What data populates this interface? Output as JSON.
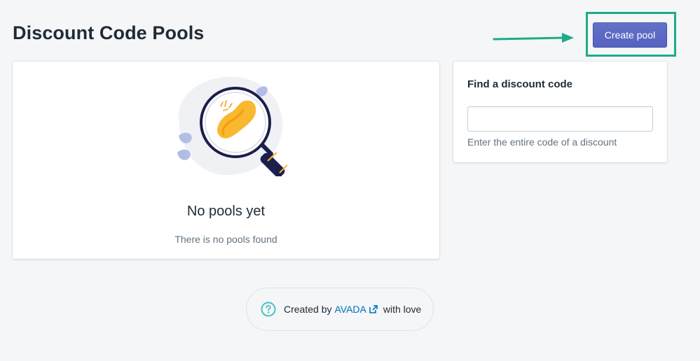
{
  "page": {
    "title": "Discount Code Pools"
  },
  "header": {
    "create_label": "Create pool"
  },
  "empty_state": {
    "title": "No pools yet",
    "subtitle": "There is no pools found",
    "icon": "magnifier-footprint-icon"
  },
  "find": {
    "title": "Find a discount code",
    "input_value": "",
    "placeholder": "",
    "help": "Enter the entire code of a discount"
  },
  "footer": {
    "prefix": "Created by",
    "link": "AVADA",
    "suffix": "with love",
    "help_icon": "question-circle-icon",
    "link_icon": "external-link-icon"
  },
  "colors": {
    "primary": "#5c6ac4",
    "highlight": "#1eab8a",
    "link": "#006fbb",
    "background": "#f4f6f8"
  }
}
